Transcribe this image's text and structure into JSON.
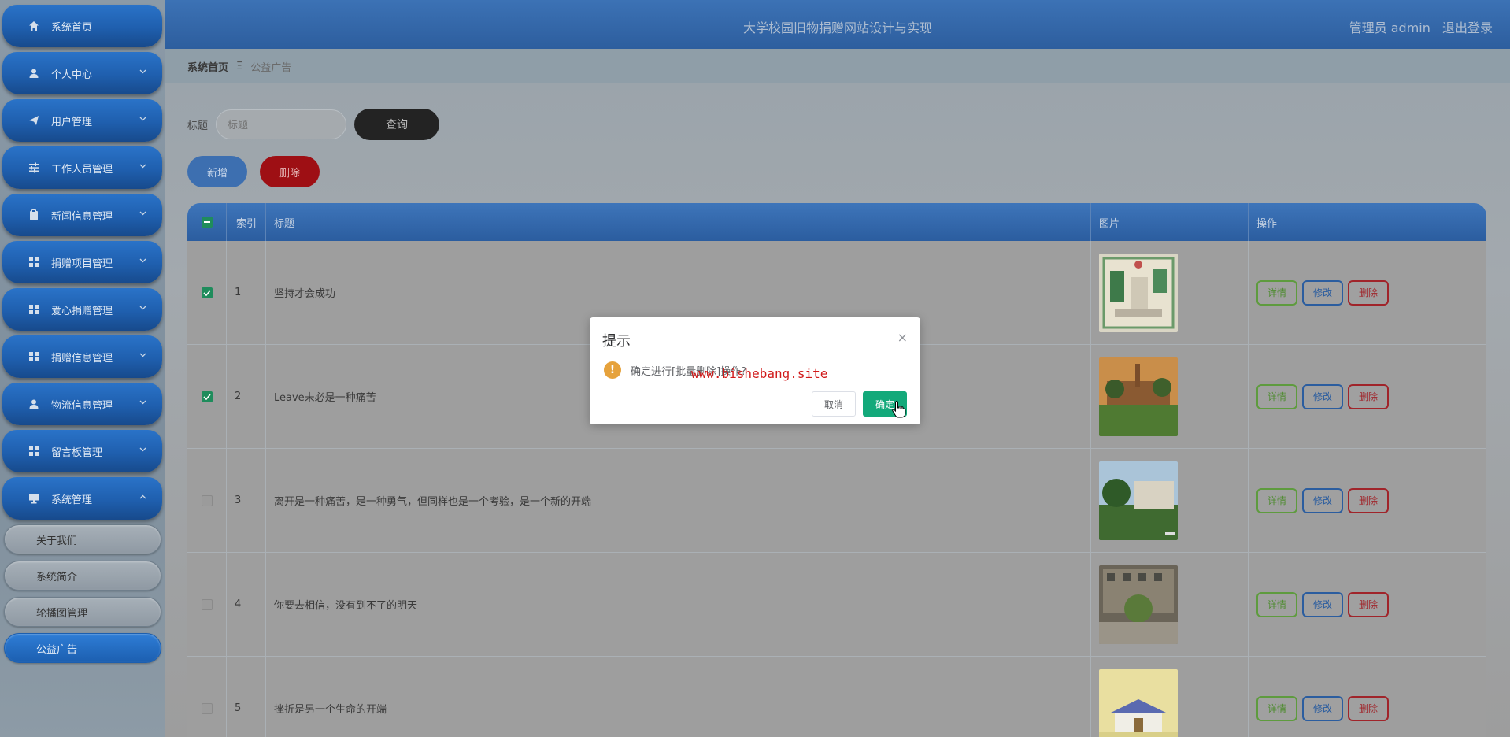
{
  "header": {
    "title": "大学校园旧物捐赠网站设计与实现",
    "user": "管理员 admin",
    "logout": "退出登录"
  },
  "sidebar": {
    "items": [
      {
        "label": "系统首页",
        "icon": "home-icon",
        "has_arrow": false
      },
      {
        "label": "个人中心",
        "icon": "user-icon",
        "has_arrow": true
      },
      {
        "label": "用户管理",
        "icon": "send-icon",
        "has_arrow": true
      },
      {
        "label": "工作人员管理",
        "icon": "sliders-icon",
        "has_arrow": true
      },
      {
        "label": "新闻信息管理",
        "icon": "clipboard-icon",
        "has_arrow": true
      },
      {
        "label": "捐赠项目管理",
        "icon": "grid-icon",
        "has_arrow": true
      },
      {
        "label": "爱心捐赠管理",
        "icon": "grid-icon",
        "has_arrow": true
      },
      {
        "label": "捐赠信息管理",
        "icon": "grid-icon",
        "has_arrow": true
      },
      {
        "label": "物流信息管理",
        "icon": "user-icon",
        "has_arrow": true
      },
      {
        "label": "留言板管理",
        "icon": "grid-icon",
        "has_arrow": true
      },
      {
        "label": "系统管理",
        "icon": "monitor-icon",
        "has_arrow": true,
        "expanded": true
      }
    ],
    "sub_items": [
      {
        "label": "关于我们"
      },
      {
        "label": "系统简介"
      },
      {
        "label": "轮播图管理"
      },
      {
        "label": "公益广告",
        "active": true
      }
    ],
    "arrow_down": "⌄",
    "arrow_up": "⌃"
  },
  "breadcrumb": {
    "home": "系统首页",
    "sep": "Ξ",
    "current": "公益广告"
  },
  "search": {
    "label": "标题",
    "placeholder": "标题",
    "query_button": "查询"
  },
  "actions": {
    "add": "新增",
    "delete": "删除"
  },
  "table": {
    "headers": {
      "index": "索引",
      "title": "标题",
      "image": "图片",
      "ops": "操作"
    },
    "rows": [
      {
        "index": "1",
        "title": "坚持才会成功",
        "checked": true
      },
      {
        "index": "2",
        "title": "Leave未必是一种痛苦",
        "checked": true
      },
      {
        "index": "3",
        "title": "离开是一种痛苦，是一种勇气，但同样也是一个考验，是一个新的开端",
        "checked": false
      },
      {
        "index": "4",
        "title": "你要去相信，没有到不了的明天",
        "checked": false
      },
      {
        "index": "5",
        "title": "挫折是另一个生命的开端",
        "checked": false
      }
    ],
    "op_labels": {
      "detail": "详情",
      "edit": "修改",
      "delete": "删除"
    }
  },
  "dialog": {
    "title": "提示",
    "close": "×",
    "message": "确定进行[批量删除]操作?",
    "watermark": "www.bishebang.site",
    "cancel": "取消",
    "confirm": "确定",
    "warn_glyph": "!"
  },
  "colors": {
    "header": "#2d5e9e",
    "confirm": "#13a97a",
    "delete": "#9e0f14",
    "warning": "#e6a23c"
  }
}
